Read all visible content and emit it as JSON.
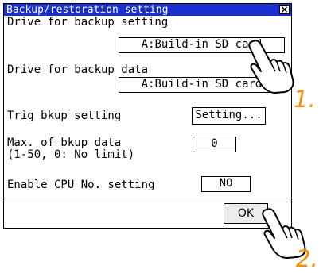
{
  "dialog": {
    "title": "Backup/restoration setting",
    "close_label": "×"
  },
  "backup_setting": {
    "label": "Drive for backup setting",
    "value": "A:Build-in SD card"
  },
  "backup_data": {
    "label": "Drive for backup data",
    "value": "A:Build-in SD card"
  },
  "trig_backup": {
    "label": "Trig bkup setting",
    "button_label": "Setting..."
  },
  "max_backup": {
    "label_line1": "Max. of bkup data",
    "label_line2": "(1-50, 0: No limit)",
    "value": "0"
  },
  "cpu_no": {
    "label": "Enable CPU No. setting",
    "value": "NO"
  },
  "footer": {
    "ok_label": "OK"
  },
  "annotations": {
    "step1": "1.",
    "step2": "2.",
    "accent_color": "#f29000",
    "titlebar_color": "#1a2fd0"
  }
}
